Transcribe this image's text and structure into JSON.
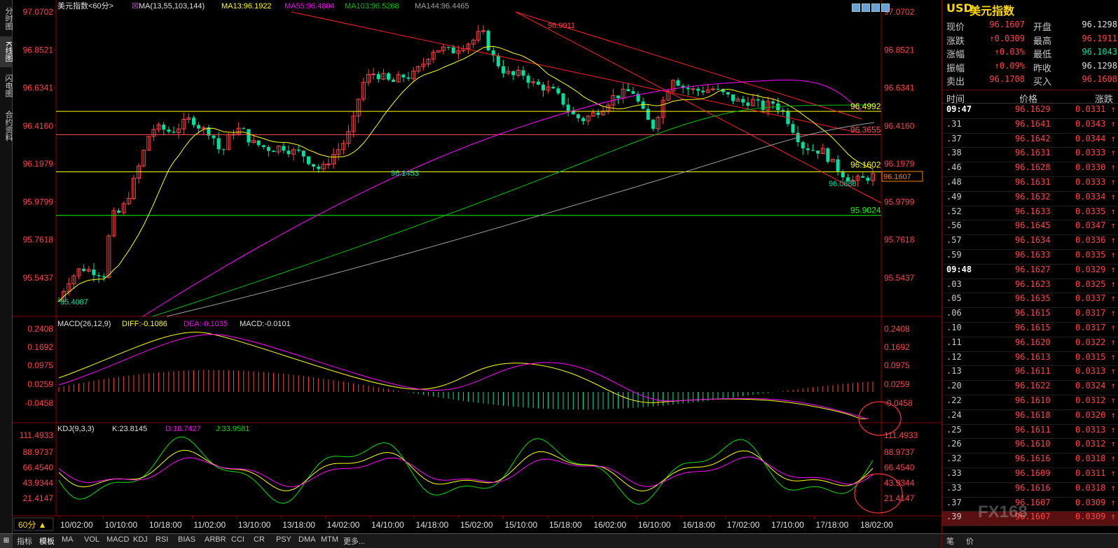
{
  "sidebar": {
    "tabs": [
      "分时图",
      "K线图",
      "闪电图",
      "合约资料"
    ]
  },
  "chart_title": {
    "name": "美元指数<60分>",
    "ma_label": "MA(13,55,103,144)",
    "ma13": "MA13:96.1922",
    "ma55": "MA55:96.4804",
    "ma103": "MA103:96.5268",
    "ma144": "MA144:96.4465"
  },
  "price_axis": {
    "left": [
      "97.0702",
      "96.8521",
      "96.6341",
      "96.4160",
      "96.1979",
      "95.9799",
      "95.7618",
      "95.5437"
    ],
    "right": [
      "97.0702",
      "96.8521",
      "96.6341",
      "96.4160",
      "96.1979",
      "95.9799",
      "95.7618",
      "95.5437"
    ]
  },
  "annotations": {
    "high": "96.9911",
    "low_left": "95.4087",
    "mid_low": "96.1453",
    "last_low": "96.0888",
    "level_upper": "96.4992",
    "level_red": "96.3655",
    "level_mid": "96.1602",
    "level_green": "95.9024",
    "current_price_tag": "96.1607"
  },
  "macd": {
    "label": "MACD(26,12,9)",
    "diff": "DIFF:-0.1086",
    "dea": "DEA:-0.1035",
    "macd": "MACD:-0.0101",
    "axis": [
      "0.2408",
      "0.1692",
      "0.0975",
      "0.0259",
      "-0.0458"
    ]
  },
  "kdj": {
    "label": "KDJ(9,3,3)",
    "k": "K:23.8145",
    "d": "D:18.7427",
    "j": "J:33.9581",
    "axis": [
      "111.4933",
      "88.9737",
      "66.4540",
      "43.9344",
      "21.4147"
    ]
  },
  "period_button": "60分",
  "time_axis": [
    "10/02:00",
    "10/10:00",
    "10/18:00",
    "11/02:00",
    "13/10:00",
    "13/18:00",
    "14/02:00",
    "14/10:00",
    "14/18:00",
    "15/02:00",
    "15/10:00",
    "15/18:00",
    "16/02:00",
    "16/10:00",
    "16/18:00",
    "17/02:00",
    "17/10:00",
    "17/18:00",
    "18/02:00"
  ],
  "bottom_tabs": [
    "指标",
    "模板",
    "MA",
    "VOL",
    "MACD",
    "KDJ",
    "RSI",
    "BIAS",
    "ARBR",
    "CCI",
    "CR",
    "PSY",
    "DMA",
    "MTM",
    "更多..."
  ],
  "quote_panel": {
    "symbol": "USD",
    "name": "美元指数",
    "rows": [
      {
        "l1": "现价",
        "v1": "96.1607",
        "l2": "开盘",
        "v2": "96.1298"
      },
      {
        "l1": "涨跌",
        "v1": "↑0.0309",
        "l2": "最高",
        "v2": "96.1911"
      },
      {
        "l1": "涨幅",
        "v1": "↑0.03%",
        "l2": "最低",
        "v2": "96.1043"
      },
      {
        "l1": "振幅",
        "v1": "↑0.09%",
        "l2": "昨收",
        "v2": "96.1298"
      },
      {
        "l1": "卖出",
        "v1": "96.1708",
        "l2": "买入",
        "v2": "96.1608"
      }
    ]
  },
  "tick_header": {
    "time": "时间",
    "price": "价格",
    "change": "涨跌"
  },
  "ticks": [
    {
      "t": "09:47",
      "p": "96.1629",
      "c": "0.0331"
    },
    {
      "t": ".31",
      "p": "96.1641",
      "c": "0.0343"
    },
    {
      "t": ".37",
      "p": "96.1642",
      "c": "0.0344"
    },
    {
      "t": ".38",
      "p": "96.1631",
      "c": "0.0333"
    },
    {
      "t": ".46",
      "p": "96.1628",
      "c": "0.0330"
    },
    {
      "t": ".48",
      "p": "96.1631",
      "c": "0.0333"
    },
    {
      "t": ".49",
      "p": "96.1632",
      "c": "0.0334"
    },
    {
      "t": ".52",
      "p": "96.1633",
      "c": "0.0335"
    },
    {
      "t": ".56",
      "p": "96.1645",
      "c": "0.0347"
    },
    {
      "t": ".57",
      "p": "96.1634",
      "c": "0.0336"
    },
    {
      "t": ".59",
      "p": "96.1633",
      "c": "0.0335"
    },
    {
      "t": "09:48",
      "p": "96.1627",
      "c": "0.0329"
    },
    {
      "t": ".03",
      "p": "96.1623",
      "c": "0.0325"
    },
    {
      "t": ".05",
      "p": "96.1635",
      "c": "0.0337"
    },
    {
      "t": ".06",
      "p": "96.1615",
      "c": "0.0317"
    },
    {
      "t": ".10",
      "p": "96.1615",
      "c": "0.0317"
    },
    {
      "t": ".11",
      "p": "96.1620",
      "c": "0.0322"
    },
    {
      "t": ".12",
      "p": "96.1613",
      "c": "0.0315"
    },
    {
      "t": ".13",
      "p": "96.1611",
      "c": "0.0313"
    },
    {
      "t": ".20",
      "p": "96.1622",
      "c": "0.0324"
    },
    {
      "t": ".22",
      "p": "96.1610",
      "c": "0.0312"
    },
    {
      "t": ".24",
      "p": "96.1618",
      "c": "0.0320"
    },
    {
      "t": ".25",
      "p": "96.1611",
      "c": "0.0313"
    },
    {
      "t": ".26",
      "p": "96.1610",
      "c": "0.0312"
    },
    {
      "t": ".32",
      "p": "96.1616",
      "c": "0.0318"
    },
    {
      "t": ".33",
      "p": "96.1609",
      "c": "0.0311"
    },
    {
      "t": ".33",
      "p": "96.1616",
      "c": "0.0318"
    },
    {
      "t": ".37",
      "p": "96.1607",
      "c": "0.0309"
    },
    {
      "t": ".39",
      "p": "96.1607",
      "c": "0.0309"
    }
  ],
  "rp_bottom": [
    "笔",
    "价"
  ],
  "watermark": "FX168",
  "colors": {
    "up": "#ff4444",
    "down": "#00e0a0",
    "ma13": "#ffff00",
    "ma55": "#ff00ff",
    "ma103": "#00c000",
    "ma144": "#a0a0a0",
    "grid": "#8b0000"
  }
}
